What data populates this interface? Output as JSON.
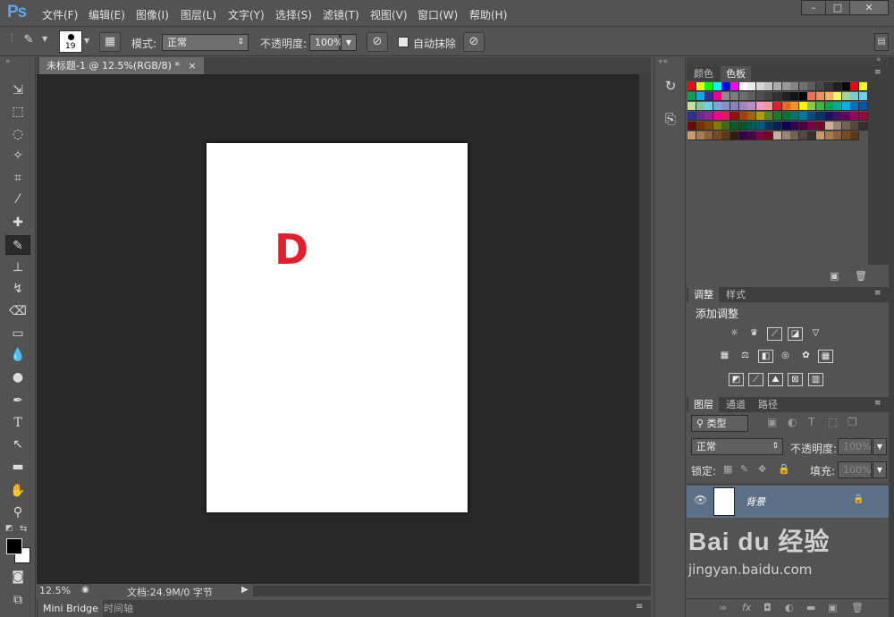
{
  "app": {
    "logo": "Ps"
  },
  "menu": [
    "文件(F)",
    "编辑(E)",
    "图像(I)",
    "图层(L)",
    "文字(Y)",
    "选择(S)",
    "滤镜(T)",
    "视图(V)",
    "窗口(W)",
    "帮助(H)"
  ],
  "window_controls": {
    "minimize": "–",
    "maximize": "□",
    "close": "✕"
  },
  "options": {
    "brush_size": "19",
    "mode_label": "模式:",
    "mode_value": "正常",
    "opacity_label": "不透明度:",
    "opacity_value": "100%",
    "auto_erase_label": "自动抹除"
  },
  "document": {
    "tab_title": "未标题-1 @ 12.5%(RGB/8) *",
    "tab_close": "×",
    "canvas_text": "D",
    "zoom": "12.5%",
    "doc_info": "文档:24.9M/0 字节"
  },
  "bottom_tabs": [
    "Mini Bridge",
    "时间轴"
  ],
  "swatches_panel": {
    "tabs": [
      "颜色",
      "色板"
    ]
  },
  "adjustments_panel": {
    "tabs": [
      "调整",
      "样式"
    ],
    "title": "添加调整",
    "rows": [
      [
        "sun-icon",
        "crown-icon",
        "curves-icon",
        "exposure-icon",
        "triangle-icon"
      ],
      [
        "grid-icon",
        "balance-icon",
        "bw-icon",
        "camera-icon",
        "mixer-icon",
        "table-icon"
      ],
      [
        "invert-icon",
        "posterize-icon",
        "threshold-icon",
        "selective-icon",
        "gradientmap-icon"
      ]
    ]
  },
  "layers_panel": {
    "tabs": [
      "图层",
      "通道",
      "路径"
    ],
    "filter_label": "类型",
    "blend_mode": "正常",
    "opacity_label": "不透明度:",
    "opacity_value": "100%",
    "lock_label": "锁定:",
    "fill_label": "填充:",
    "fill_value": "100%",
    "layer_name": "背景"
  },
  "watermark": {
    "brand": "Bai du 经验",
    "url": "jingyan.baidu.com"
  },
  "colors": {
    "canvas_bg": "#282828",
    "ui_bg": "#535353",
    "accent_red": "#e31e2d",
    "layer_selected": "#5b6f86"
  }
}
